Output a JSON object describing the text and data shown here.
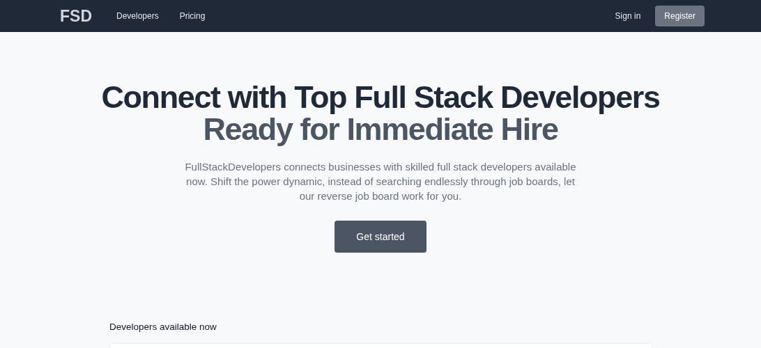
{
  "nav": {
    "logo": "FSD",
    "links": [
      {
        "label": "Developers"
      },
      {
        "label": "Pricing"
      }
    ],
    "sign_in": "Sign in",
    "register": "Register"
  },
  "hero": {
    "title_line1": "Connect with Top Full Stack Developers",
    "title_line2": "Ready for Immediate Hire",
    "description": "FullStackDevelopers connects businesses with skilled full stack developers available now. Shift the power dynamic, instead of searching endlessly through job boards, let our reverse job board work for you.",
    "cta": "Get started"
  },
  "developers": {
    "heading": "Developers available now"
  }
}
